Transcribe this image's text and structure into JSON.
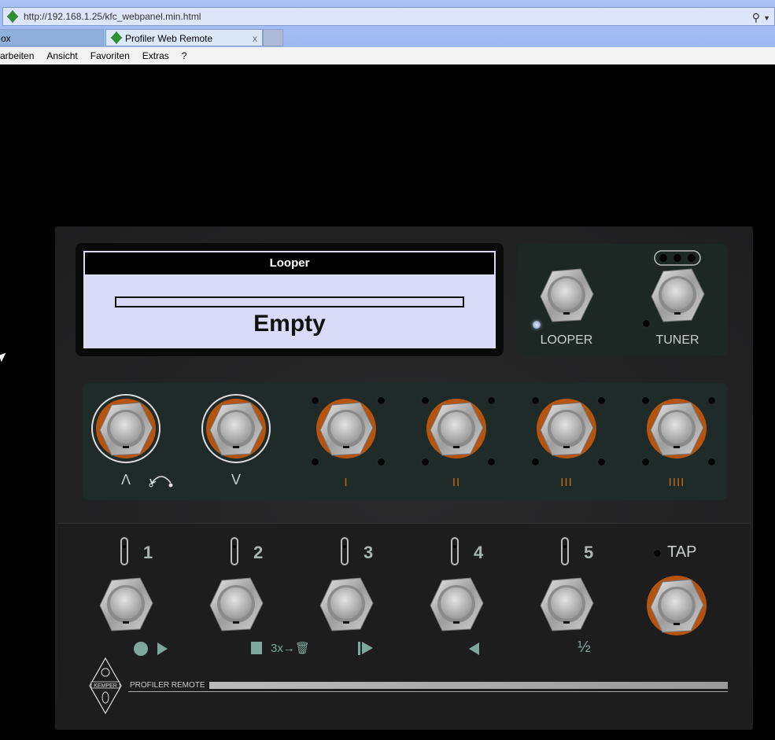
{
  "browser": {
    "url": "http://192.168.1.25/kfc_webpanel.min.html",
    "tabs": [
      {
        "label": "ox"
      },
      {
        "label": "Profiler Web Remote",
        "close": "x"
      }
    ],
    "menu": [
      "arbeiten",
      "Ansicht",
      "Favoriten",
      "Extras",
      "?"
    ]
  },
  "display": {
    "title": "Looper",
    "status": "Empty",
    "progress": 0
  },
  "right_panel": {
    "looper_label": "LOOPER",
    "tuner_label": "TUNER"
  },
  "rig_row": {
    "labels": [
      "Λ",
      "V",
      "I",
      "II",
      "III",
      "IIII"
    ]
  },
  "looper_row": {
    "numbers": [
      "1",
      "2",
      "3",
      "4",
      "5"
    ],
    "tap_label": "TAP",
    "functions": {
      "stop_erase": "3x→🗑",
      "half": "½"
    }
  },
  "branding": {
    "logo_text": "KEMPER",
    "product": "PROFILER REMOTE"
  },
  "colors": {
    "accent_orange": "#c46a1c",
    "panel_green": "#1f2b28",
    "teal": "#7fa79d"
  }
}
